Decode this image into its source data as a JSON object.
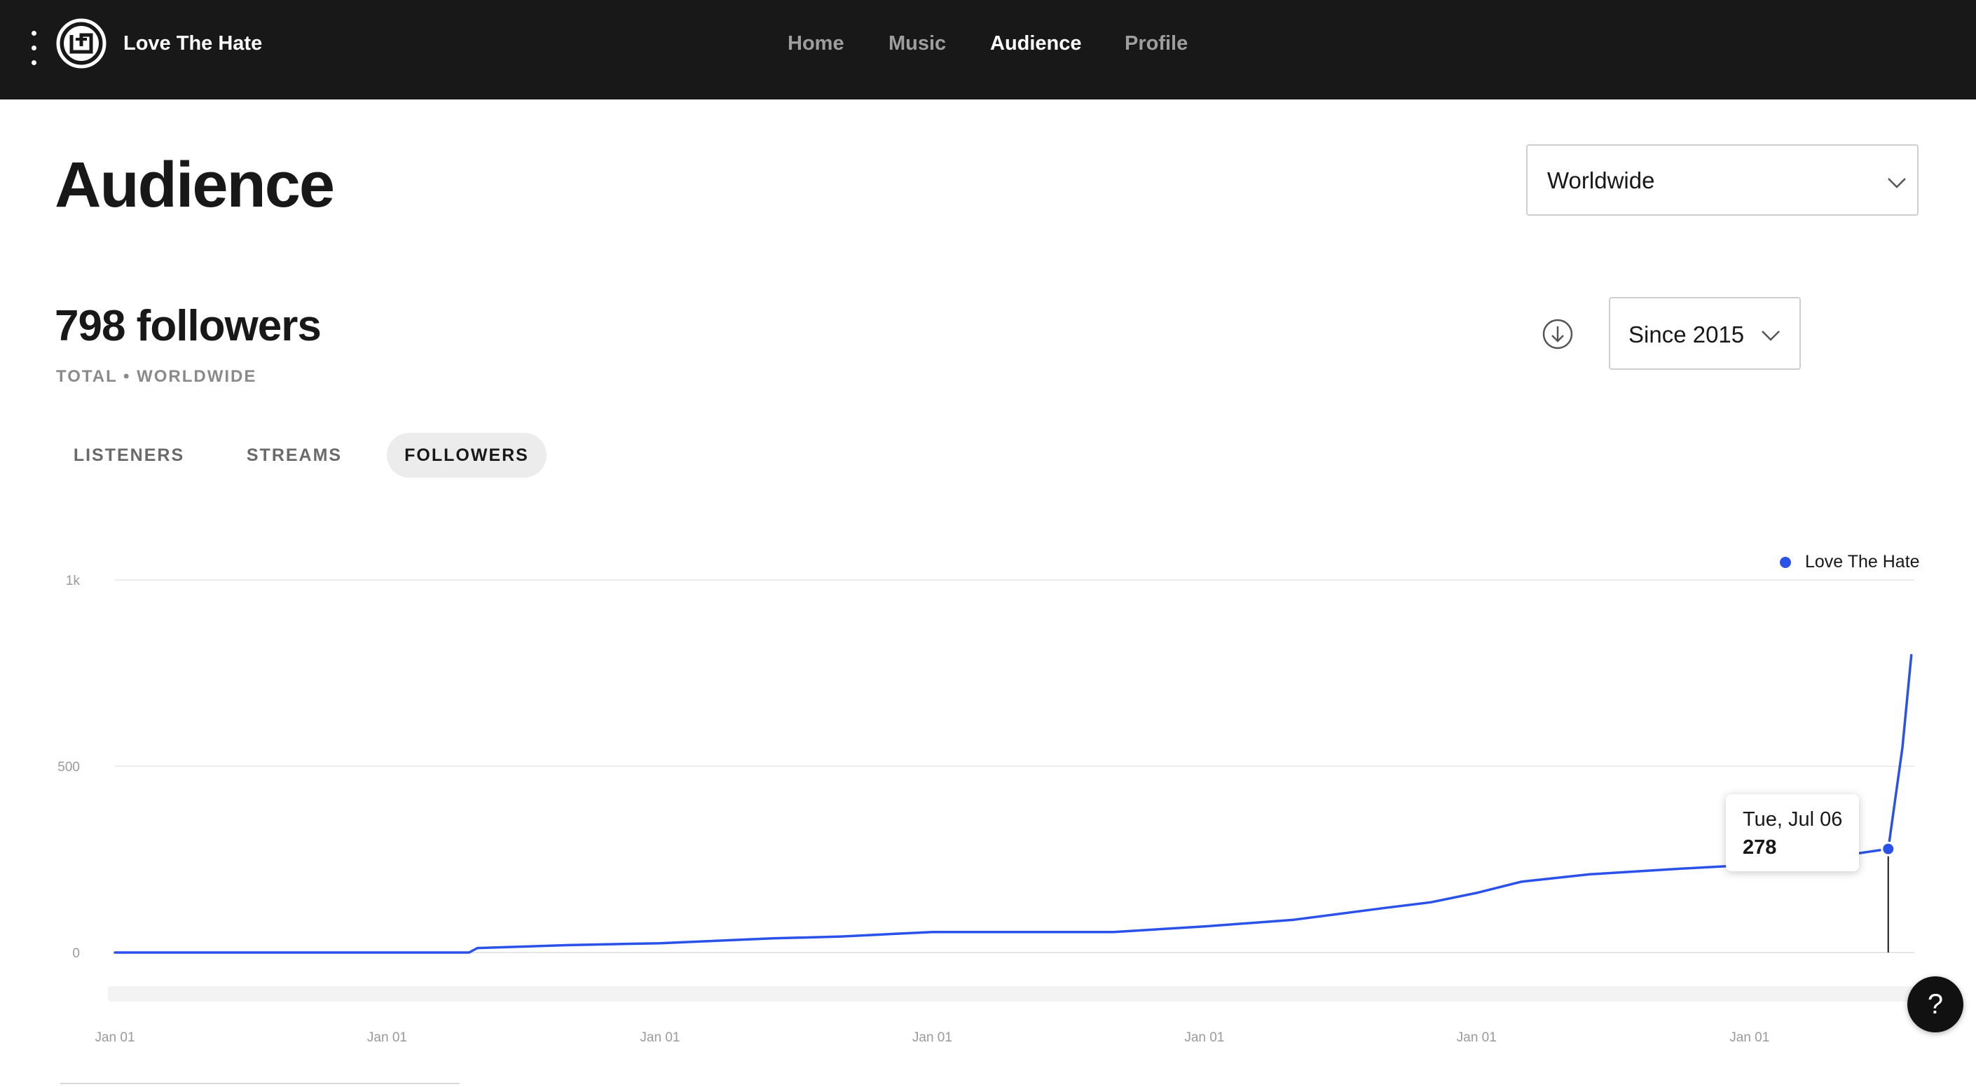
{
  "header": {
    "artist_name": "Love The Hate",
    "nav": [
      {
        "label": "Home",
        "active": false
      },
      {
        "label": "Music",
        "active": false
      },
      {
        "label": "Audience",
        "active": true
      },
      {
        "label": "Profile",
        "active": false
      }
    ],
    "menu_icon": "kebab-menu-icon",
    "logo_icon": "artist-logo-icon"
  },
  "page": {
    "title": "Audience",
    "region_select": {
      "value": "Worldwide"
    },
    "followers_heading": "798 followers",
    "subtitle": "TOTAL • WORLDWIDE",
    "range_select": {
      "value": "Since 2015"
    },
    "download_icon": "download-icon",
    "tabs": [
      {
        "label": "LISTENERS",
        "active": false
      },
      {
        "label": "STREAMS",
        "active": false
      },
      {
        "label": "FOLLOWERS",
        "active": true
      }
    ]
  },
  "tooltip": {
    "date": "Tue, Jul 06",
    "value": "278"
  },
  "help": {
    "label": "?"
  },
  "colors": {
    "accent": "#2a52e8",
    "topbar": "#181818",
    "tab_active_bg": "#ececec"
  },
  "chart_data": {
    "type": "line",
    "title": "",
    "xlabel": "",
    "ylabel": "",
    "ylim": [
      0,
      1000
    ],
    "y_ticks": [
      {
        "value": 0,
        "label": "0"
      },
      {
        "value": 500,
        "label": "500"
      },
      {
        "value": 1000,
        "label": "1k"
      }
    ],
    "x_tick_labels": [
      "Jan 01",
      "Jan 01",
      "Jan 01",
      "Jan 01",
      "Jan 01",
      "Jan 01",
      "Jan 01"
    ],
    "x_ticks": [
      "2015-01-01",
      "2016-01-01",
      "2017-01-01",
      "2018-01-01",
      "2019-01-01",
      "2020-01-01",
      "2021-01-01"
    ],
    "xlim": [
      "2015-01-01",
      "2021-08-10"
    ],
    "legend_position": "top-right",
    "grid": true,
    "series": [
      {
        "name": "Love The Hate",
        "color": "#2a52e8",
        "points": [
          [
            "2015-01-01",
            0
          ],
          [
            "2016-04-20",
            0
          ],
          [
            "2016-05-01",
            12
          ],
          [
            "2016-09-01",
            20
          ],
          [
            "2017-01-01",
            25
          ],
          [
            "2017-03-01",
            30
          ],
          [
            "2017-06-01",
            38
          ],
          [
            "2017-09-01",
            43
          ],
          [
            "2018-01-01",
            55
          ],
          [
            "2018-06-01",
            55
          ],
          [
            "2018-09-01",
            55
          ],
          [
            "2019-01-01",
            70
          ],
          [
            "2019-05-01",
            88
          ],
          [
            "2019-09-01",
            120
          ],
          [
            "2019-11-01",
            135
          ],
          [
            "2020-01-01",
            160
          ],
          [
            "2020-03-01",
            190
          ],
          [
            "2020-06-01",
            210
          ],
          [
            "2020-10-01",
            225
          ],
          [
            "2021-01-01",
            235
          ],
          [
            "2021-04-01",
            250
          ],
          [
            "2021-07-06",
            278
          ],
          [
            "2021-07-25",
            550
          ],
          [
            "2021-08-06",
            798
          ]
        ]
      }
    ],
    "highlight": {
      "x": "2021-07-06",
      "y": 278
    }
  }
}
